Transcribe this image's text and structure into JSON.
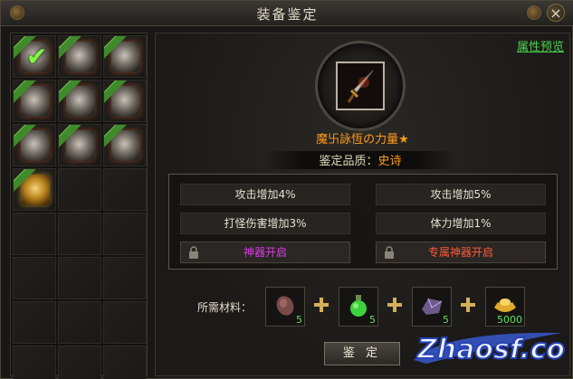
{
  "window": {
    "title": "装备鉴定",
    "close_glyph": "×"
  },
  "header": {
    "preview_link": "属性预览"
  },
  "inventory": {
    "slots": [
      {
        "filled": true,
        "kind": "check"
      },
      {
        "filled": true,
        "kind": "gear"
      },
      {
        "filled": true,
        "kind": "gear"
      },
      {
        "filled": true,
        "kind": "gear"
      },
      {
        "filled": true,
        "kind": "gear"
      },
      {
        "filled": true,
        "kind": "gear"
      },
      {
        "filled": true,
        "kind": "gear"
      },
      {
        "filled": true,
        "kind": "gear"
      },
      {
        "filled": true,
        "kind": "gear"
      },
      {
        "filled": true,
        "kind": "gold"
      }
    ],
    "total_slots": 24
  },
  "item": {
    "name": "魔卐詠恆の力量★",
    "quality_label": "鉴定品质：",
    "quality_value": "史诗"
  },
  "stats": {
    "left": [
      "攻击增加4%",
      "打怪伤害增加3%"
    ],
    "right": [
      "攻击增加5%",
      "体力增加1%"
    ],
    "artifact_button": "神器开启",
    "exclusive_button": "专属神器开启"
  },
  "materials": {
    "label": "所需材料：",
    "items": [
      {
        "name": "stone",
        "count": "5"
      },
      {
        "name": "potion",
        "count": "5"
      },
      {
        "name": "crystal",
        "count": "5"
      },
      {
        "name": "gold-ingot",
        "count": "5000"
      }
    ]
  },
  "actions": {
    "identify": "鉴 定"
  },
  "watermark": {
    "text": "Zhaosf.co"
  }
}
